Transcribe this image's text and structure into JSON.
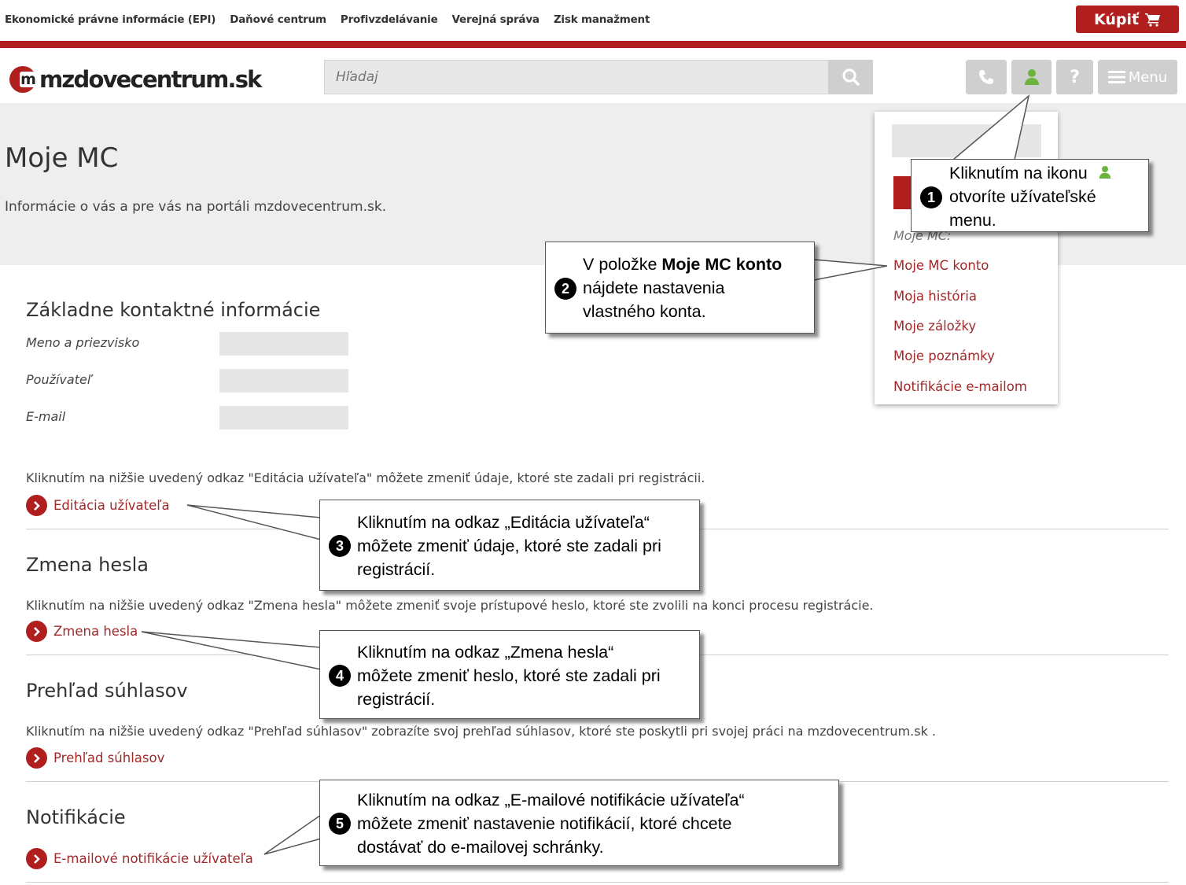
{
  "topnav": {
    "links": [
      "Ekonomické právne informácie (EPI)",
      "Daňové centrum",
      "Profivzdelávanie",
      "Verejná správa",
      "Zisk manažment"
    ],
    "buy_label": "Kúpiť"
  },
  "header": {
    "logo_text": "mzdovecentrum.sk",
    "search_placeholder": "Hľadaj",
    "menu_label": "Menu",
    "help_label": "?"
  },
  "banner": {
    "title": "Moje MC",
    "subtitle": "Informácie o vás a pre vás na portáli mzdovecentrum.sk."
  },
  "dropdown": {
    "section_label": "Moje MC:",
    "items": [
      "Moje MC konto",
      "Moja história",
      "Moje záložky",
      "Moje poznámky",
      "Notifikácie e-mailom"
    ]
  },
  "contact": {
    "heading": "Základne kontaktné informácie",
    "fields": [
      "Meno a priezvisko",
      "Používateľ",
      "E-mail"
    ]
  },
  "sections": {
    "edit_desc": "Kliknutím na nižšie uvedený odkaz \"Editácia užívateľa\" môžete zmeniť údaje, ktoré ste zadali pri registrácii.",
    "edit_link": "Editácia užívateľa",
    "password_heading": "Zmena hesla",
    "password_desc": "Kliknutím na nižšie uvedený odkaz \"Zmena hesla\" môžete zmeniť svoje prístupové heslo, ktoré ste zvolili na konci procesu registrácie.",
    "password_link": "Zmena hesla",
    "consent_heading": "Prehľad súhlasov",
    "consent_desc": "Kliknutím na nižšie uvedený odkaz \"Prehľad súhlasov\" zobrazíte svoj prehľad súhlasov, ktoré ste poskytli pri svojej práci na mzdovecentrum.sk .",
    "consent_link": "Prehľad súhlasov",
    "notif_heading": "Notifikácie",
    "notif_link": "E-mailové notifikácie užívateľa"
  },
  "callouts": {
    "c1": {
      "num": "1",
      "line1": "Kliknutím na ikonu",
      "line2": "otvoríte užívateľské",
      "line3": "menu."
    },
    "c2": {
      "num": "2",
      "line1_pre": "V položke ",
      "line1_bold": "Moje MC konto",
      "line2": "nájdete nastavenia",
      "line3": "vlastného konta."
    },
    "c3": {
      "num": "3",
      "line1": "Kliknutím na odkaz „Editácia užívateľa“",
      "line2": "môžete zmeniť údaje, ktoré ste zadali pri",
      "line3": "registrácií."
    },
    "c4": {
      "num": "4",
      "line1": "Kliknutím na odkaz „Zmena hesla“",
      "line2": "môžete zmeniť heslo, ktoré ste zadali pri",
      "line3": "registrácií."
    },
    "c5": {
      "num": "5",
      "line1": "Kliknutím na odkaz „E-mailové notifikácie užívateľa“",
      "line2": "môžete zmeniť nastavenie notifikácií, ktoré chcete",
      "line3": "dostávať do e-mailovej schránky."
    }
  },
  "colors": {
    "brand_red": "#b01e1e",
    "link_red": "#a0292a",
    "user_icon_green": "#6cb33e"
  }
}
